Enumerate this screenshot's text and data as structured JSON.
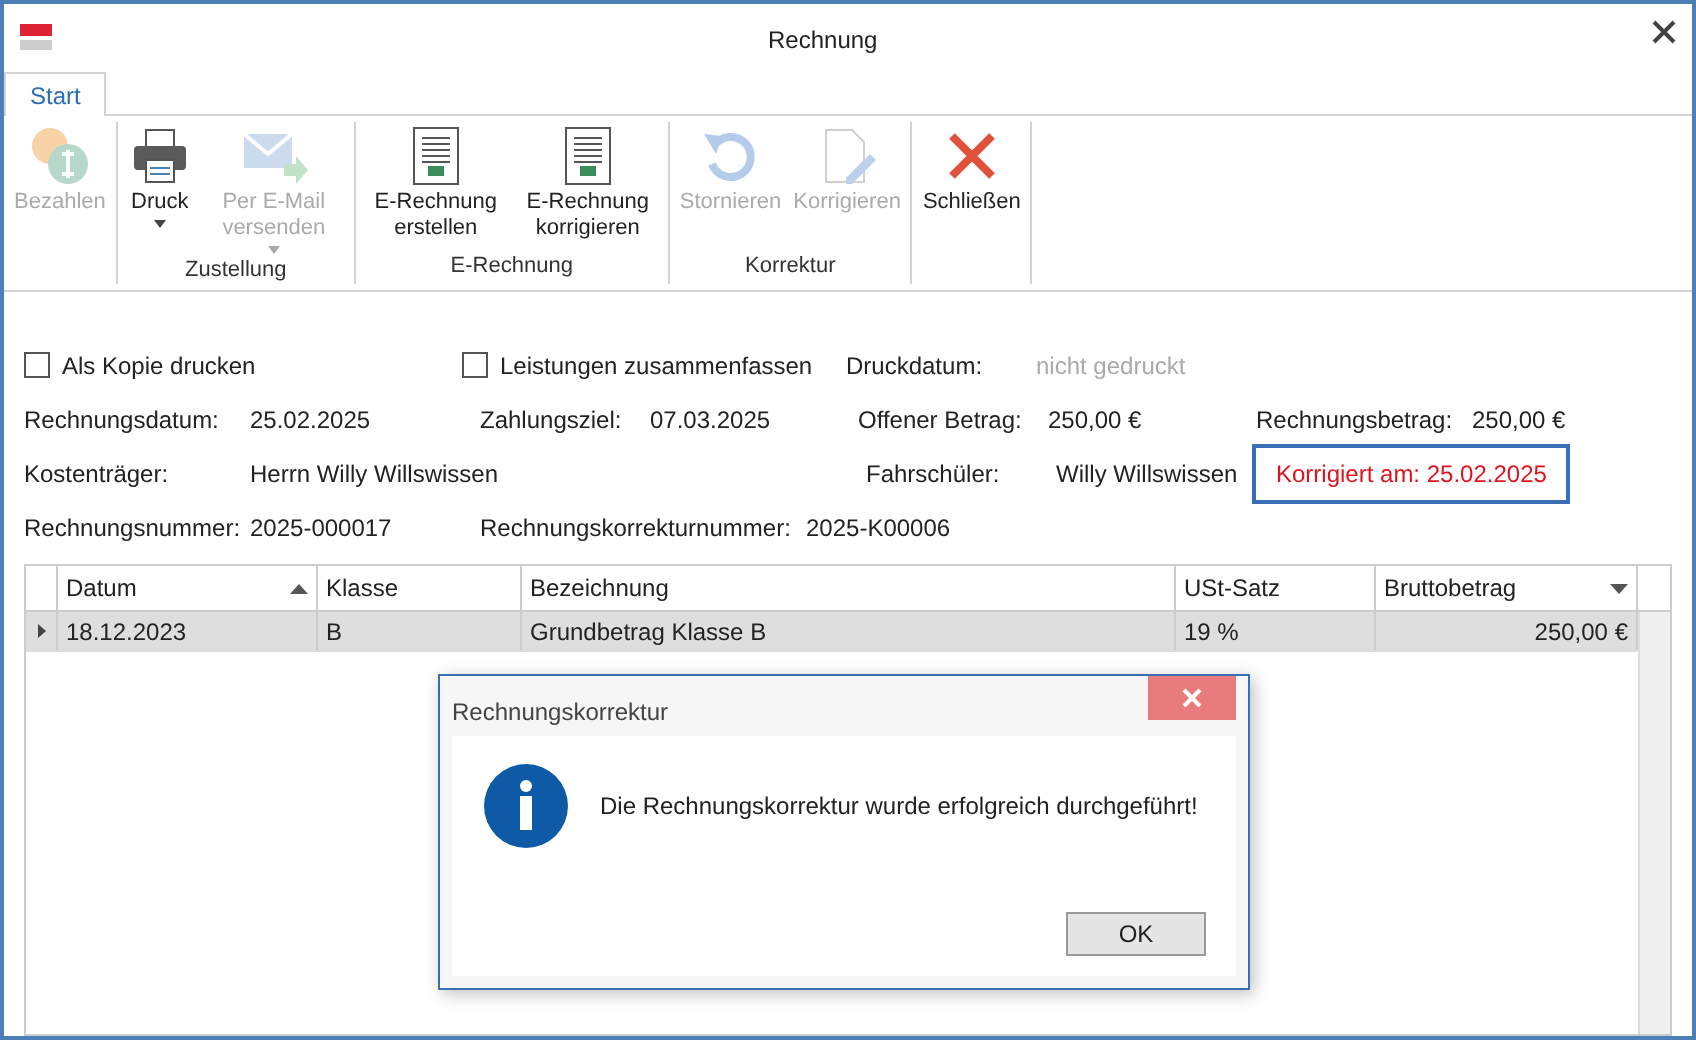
{
  "window": {
    "title": "Rechnung"
  },
  "tabs": [
    {
      "label": "Start",
      "selected": true
    }
  ],
  "ribbon": {
    "groups": [
      {
        "buttons": [
          {
            "label": "Bezahlen",
            "disabled": true,
            "dropdown": false
          }
        ]
      },
      {
        "label": "Zustellung",
        "buttons": [
          {
            "label": "Druck",
            "disabled": false,
            "dropdown": true
          },
          {
            "label": "Per E-Mail versenden",
            "disabled": true,
            "dropdown": true
          }
        ]
      },
      {
        "label": "E-Rechnung",
        "buttons": [
          {
            "label": "E-Rechnung erstellen",
            "disabled": false,
            "dropdown": false
          },
          {
            "label": "E-Rechnung korrigieren",
            "disabled": false,
            "dropdown": false
          }
        ]
      },
      {
        "label": "Korrektur",
        "buttons": [
          {
            "label": "Stornieren",
            "disabled": true,
            "dropdown": false
          },
          {
            "label": "Korrigieren",
            "disabled": true,
            "dropdown": false
          }
        ]
      },
      {
        "buttons": [
          {
            "label": "Schließen",
            "disabled": false,
            "dropdown": false
          }
        ]
      }
    ]
  },
  "fields": [
    [
      {
        "kind": "checkbox",
        "label": "Als Kopie drucken",
        "checked": false
      },
      {
        "kind": "checkbox",
        "label": "Leistungen zusammenfassen",
        "checked": false
      },
      {
        "kind": "pair",
        "label": "Druckdatum:",
        "value": "nicht gedruckt",
        "muted": true
      }
    ],
    [
      {
        "kind": "pair",
        "label": "Rechnungsdatum:",
        "value": "25.02.2025",
        "muted": false
      },
      {
        "kind": "pair",
        "label": "Zahlungsziel:",
        "value": "07.03.2025",
        "muted": false
      },
      {
        "kind": "pair",
        "label": "Offener Betrag:",
        "value": "250,00 €",
        "muted": false
      },
      {
        "kind": "pair",
        "label": "Rechnungsbetrag:",
        "value": "250,00 €",
        "muted": false
      }
    ],
    [
      {
        "kind": "pair",
        "label": "Kostenträger:",
        "value": "Herrn Willy Willswissen",
        "muted": false
      },
      {
        "kind": "pair",
        "label": "Fahrschüler:",
        "value": "Willy Willswissen",
        "muted": false
      },
      {
        "kind": "badge",
        "text": "Korrigiert am: 25.02.2025"
      }
    ],
    [
      {
        "kind": "pair",
        "label": "Rechnungsnummer:",
        "value": "2025-000017",
        "muted": false
      },
      {
        "kind": "pair",
        "label": "Rechnungskorrekturnummer:",
        "value": "2025-K00006",
        "muted": false
      }
    ]
  ],
  "table": {
    "columns": [
      {
        "label": "Datum",
        "sorted": true,
        "dropdown": false
      },
      {
        "label": "Klasse",
        "sorted": false,
        "dropdown": false
      },
      {
        "label": "Bezeichnung",
        "sorted": false,
        "dropdown": false
      },
      {
        "label": "USt-Satz",
        "sorted": false,
        "dropdown": false
      },
      {
        "label": "Bruttobetrag",
        "sorted": false,
        "dropdown": true
      }
    ],
    "rows": [
      {
        "selected": true,
        "cells": [
          "18.12.2023",
          "B",
          "Grundbetrag Klasse B",
          "19 %",
          "250,00 €"
        ]
      }
    ]
  },
  "dialog": {
    "title": "Rechnungskorrektur",
    "message": "Die Rechnungskorrektur wurde erfolgreich durchgeführt!",
    "buttons": [
      "OK"
    ]
  }
}
